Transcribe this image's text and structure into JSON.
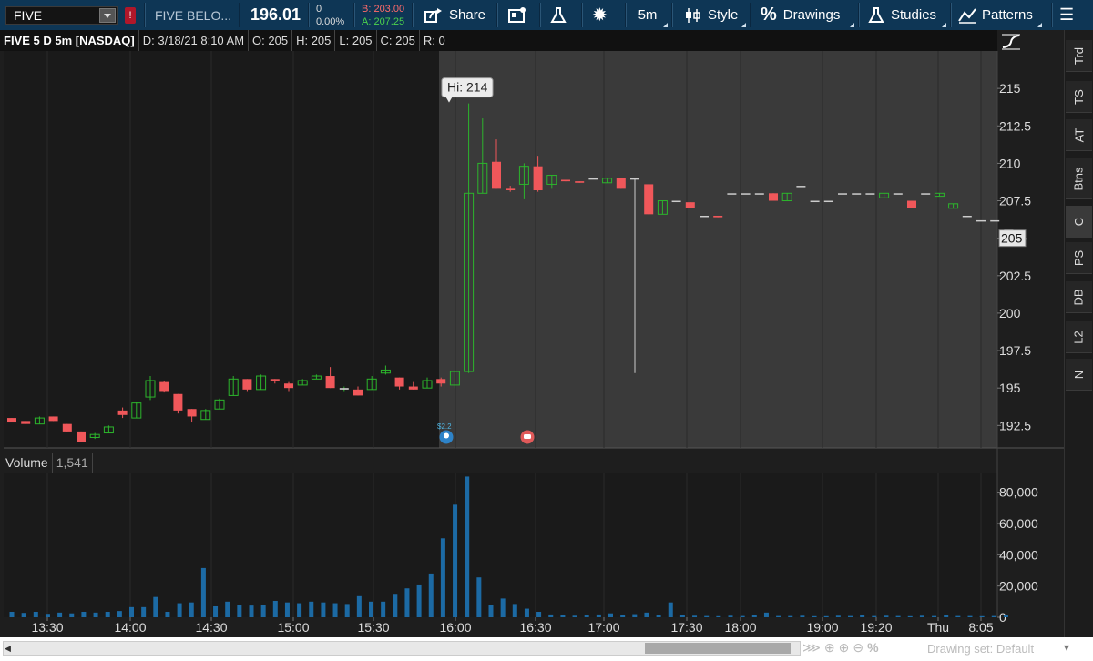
{
  "toolbar": {
    "symbol": "FIVE",
    "company": "FIVE BELO...",
    "last": "196.01",
    "change": "0",
    "change_pct": "0.00%",
    "bid": "B: 203.00",
    "ask": "A: 207.25",
    "share_label": "Share",
    "interval_label": "5m",
    "style_label": "Style",
    "drawings_label": "Drawings",
    "studies_label": "Studies",
    "patterns_label": "Patterns"
  },
  "chart_header": {
    "title": "FIVE 5 D 5m [NASDAQ]",
    "date": "D: 3/18/21 8:10 AM",
    "open": "O: 205",
    "high": "H: 205",
    "low": "L: 205",
    "close": "C: 205",
    "range": "R: 0"
  },
  "volume_header": {
    "label": "Volume",
    "value": "1,541"
  },
  "annotations": {
    "hi_label": "Hi: 214",
    "price_marker": "205",
    "event_label": "$2.2"
  },
  "side_tabs": [
    "Trd",
    "TS",
    "AT",
    "Btns",
    "C",
    "PS",
    "DB",
    "L2",
    "N"
  ],
  "bottom": {
    "drawing_set": "Drawing set: Default"
  },
  "colors": {
    "up": "#2cb52c",
    "down": "#f0575a",
    "volume": "#1c6aa4",
    "topbar": "#0e3655",
    "extended_hours": "#3a3a3a"
  },
  "chart_data": {
    "type": "candlestick",
    "price_axis": {
      "ylim": [
        191,
        217.5
      ],
      "ticks": [
        "192.5",
        "195",
        "197.5",
        "200",
        "202.5",
        "205",
        "207.5",
        "210",
        "212.5",
        "215"
      ]
    },
    "volume_axis": {
      "ylim": [
        0,
        92000
      ],
      "ticks": [
        "0",
        "20,000",
        "40,000",
        "60,000",
        "80,000"
      ]
    },
    "time_ticks": [
      "13:30",
      "14:00",
      "14:30",
      "15:00",
      "15:30",
      "16:00",
      "16:30",
      "17:00",
      "17:30",
      "18:00",
      "19:00",
      "19:20",
      "Thu",
      "8:05"
    ],
    "candles": [
      [
        193.0,
        193.0,
        192.7,
        192.7
      ],
      [
        192.8,
        192.8,
        192.6,
        192.6
      ],
      [
        192.6,
        193.1,
        192.6,
        193.0
      ],
      [
        193.1,
        193.1,
        192.8,
        192.8
      ],
      [
        192.6,
        192.6,
        192.1,
        192.1
      ],
      [
        192.1,
        192.1,
        191.4,
        191.4
      ],
      [
        191.7,
        192.0,
        191.6,
        191.9
      ],
      [
        192.0,
        192.5,
        192.0,
        192.4
      ],
      [
        193.5,
        193.7,
        193.0,
        193.2
      ],
      [
        193.0,
        194.1,
        193.0,
        194.0
      ],
      [
        194.4,
        195.8,
        194.2,
        195.5
      ],
      [
        195.4,
        195.5,
        194.7,
        194.8
      ],
      [
        194.6,
        194.6,
        193.3,
        193.5
      ],
      [
        193.6,
        193.6,
        192.7,
        193.1
      ],
      [
        192.9,
        193.6,
        192.9,
        193.5
      ],
      [
        193.6,
        194.3,
        193.6,
        194.2
      ],
      [
        194.5,
        195.8,
        194.5,
        195.6
      ],
      [
        195.6,
        195.6,
        194.8,
        194.9
      ],
      [
        194.9,
        195.9,
        194.9,
        195.8
      ],
      [
        195.6,
        195.6,
        195.3,
        195.5
      ],
      [
        195.3,
        195.4,
        194.8,
        195.0
      ],
      [
        195.2,
        195.6,
        195.2,
        195.5
      ],
      [
        195.6,
        195.9,
        195.6,
        195.8
      ],
      [
        195.8,
        196.4,
        195.0,
        195.0
      ],
      [
        194.9,
        195.1,
        194.8,
        195.0
      ],
      [
        194.9,
        195.1,
        194.5,
        194.5
      ],
      [
        194.9,
        195.8,
        194.9,
        195.6
      ],
      [
        196.0,
        196.5,
        195.9,
        196.2
      ],
      [
        195.7,
        195.7,
        194.9,
        195.1
      ],
      [
        195.1,
        195.4,
        194.9,
        194.9
      ],
      [
        195.0,
        195.7,
        195.0,
        195.5
      ],
      [
        195.6,
        195.7,
        195.1,
        195.3
      ],
      [
        195.2,
        196.2,
        195.0,
        196.1
      ],
      [
        196.1,
        214.0,
        196.0,
        208.0
      ],
      [
        208.0,
        213.0,
        208.0,
        210.0
      ],
      [
        210.1,
        211.6,
        208.3,
        208.3
      ],
      [
        208.3,
        208.5,
        208.1,
        208.2
      ],
      [
        208.6,
        210.0,
        207.6,
        209.8
      ],
      [
        209.8,
        210.5,
        208.1,
        208.2
      ],
      [
        208.6,
        209.2,
        208.3,
        209.2
      ],
      [
        208.9,
        208.9,
        208.8,
        208.8
      ],
      [
        208.8,
        208.8,
        208.7,
        208.7
      ],
      [
        209.0,
        209.0,
        209.0,
        209.0
      ],
      [
        208.7,
        209.0,
        208.7,
        209.0
      ],
      [
        209.0,
        209.0,
        208.3,
        208.3
      ],
      [
        209.0,
        209.0,
        196.0,
        209.0
      ],
      [
        208.6,
        208.6,
        206.6,
        206.6
      ],
      [
        206.6,
        207.5,
        206.6,
        207.5
      ],
      [
        207.5,
        207.5,
        207.5,
        207.5
      ],
      [
        207.4,
        207.4,
        207.0,
        207.0
      ],
      [
        206.5,
        206.5,
        206.5,
        206.5
      ],
      [
        206.5,
        206.5,
        206.4,
        206.4
      ],
      [
        208.0,
        208.0,
        208.0,
        208.0
      ],
      [
        208.0,
        208.0,
        208.0,
        208.0
      ],
      [
        208.0,
        208.0,
        208.0,
        208.0
      ],
      [
        208.0,
        208.0,
        207.5,
        207.5
      ],
      [
        207.5,
        208.0,
        207.5,
        208.0
      ],
      [
        208.5,
        208.5,
        208.5,
        208.5
      ],
      [
        207.5,
        207.5,
        207.5,
        207.5
      ],
      [
        207.5,
        207.5,
        207.5,
        207.5
      ],
      [
        208.0,
        208.0,
        208.0,
        208.0
      ],
      [
        208.0,
        208.0,
        208.0,
        208.0
      ],
      [
        208.0,
        208.0,
        208.0,
        208.0
      ],
      [
        207.7,
        208.0,
        207.7,
        208.0
      ],
      [
        208.0,
        208.0,
        208.0,
        208.0
      ],
      [
        207.5,
        207.5,
        207.0,
        207.0
      ],
      [
        208.0,
        208.0,
        208.0,
        208.0
      ],
      [
        207.8,
        208.0,
        207.8,
        208.0
      ],
      [
        207.0,
        207.3,
        207.0,
        207.3
      ],
      [
        206.5,
        206.5,
        206.5,
        206.5
      ],
      [
        206.2,
        206.2,
        206.2,
        206.2
      ],
      [
        206.2,
        206.2,
        206.2,
        206.2
      ],
      [
        205.6,
        205.6,
        205.6,
        205.6
      ],
      [
        205.0,
        205.0,
        205.0,
        205.0
      ]
    ],
    "volumes": [
      3500,
      2800,
      3500,
      2200,
      3000,
      2500,
      3500,
      3000,
      3500,
      4000,
      6500,
      6500,
      13000,
      3500,
      9000,
      9500,
      31500,
      7000,
      10000,
      8000,
      7500,
      8000,
      10500,
      9500,
      9000,
      10000,
      9500,
      9000,
      8500,
      13500,
      10000,
      10000,
      15000,
      18500,
      21000,
      28000,
      50500,
      72000,
      90000,
      25500,
      8000,
      12000,
      8500,
      5500,
      3500,
      1800,
      1200,
      1000,
      1500,
      1800,
      2500,
      1500,
      2000,
      3000,
      1200,
      9500,
      1500,
      1000,
      800,
      700,
      1000,
      800,
      1200,
      3000,
      800,
      800,
      1000,
      700,
      700,
      1000,
      800,
      1500,
      800,
      1000,
      800,
      700,
      1000,
      800,
      1500,
      800,
      800,
      700,
      800,
      1541
    ]
  }
}
